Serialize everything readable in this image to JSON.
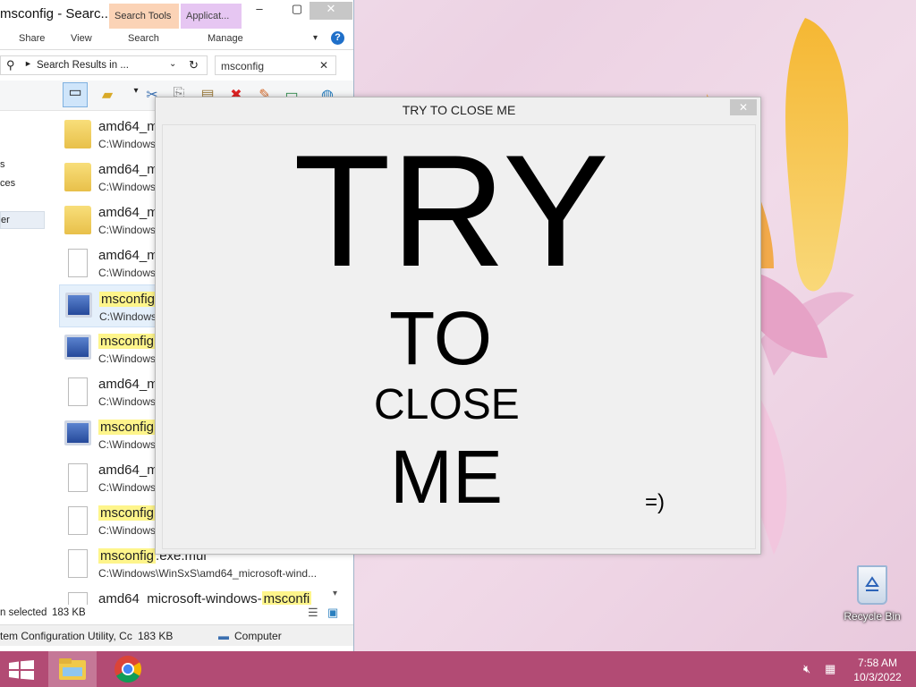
{
  "explorer": {
    "title": "msconfig - Searc...",
    "contextual_tabs": {
      "search_tools": "Search Tools",
      "application": "Applicat..."
    },
    "ribbon_tabs": [
      "Share",
      "View",
      "Search",
      "Manage"
    ],
    "address": "Search Results in ...",
    "search_value": "msconfig",
    "nav_items": [
      "s",
      "ces",
      "er"
    ],
    "files": [
      {
        "name": "amd64_m",
        "highlight": "",
        "path": "C:\\Windows",
        "icon": "folder-icon"
      },
      {
        "name": "amd64_m",
        "highlight": "",
        "path": "C:\\Windows",
        "icon": "folder-icon"
      },
      {
        "name": "amd64_m",
        "highlight": "",
        "path": "C:\\Windows",
        "icon": "folder-icon"
      },
      {
        "name": "amd64_m",
        "highlight": "",
        "path": "C:\\Windows",
        "icon": "file-icon"
      },
      {
        "name": "",
        "highlight": "msconfig",
        "path": "C:\\Windows",
        "icon": "msconfig-app-icon"
      },
      {
        "name": "",
        "highlight": "msconfig",
        "path": "C:\\Windows",
        "icon": "msconfig-app-icon"
      },
      {
        "name": "amd64_m",
        "highlight": "",
        "path": "C:\\Windows",
        "icon": "file-icon"
      },
      {
        "name": "",
        "highlight": "msconfig",
        "path": "C:\\Windows",
        "icon": "msconfig-app-icon"
      },
      {
        "name": "amd64_m",
        "highlight": "",
        "path": "C:\\Windows",
        "icon": "file-icon"
      },
      {
        "name": "",
        "highlight": "msconfig",
        "path": "C:\\Windows",
        "icon": "file-icon"
      },
      {
        "name": ".exe.mui",
        "highlight": "msconfig",
        "path": "C:\\Windows\\WinSxS\\amd64_microsoft-wind...",
        "icon": "file-icon"
      },
      {
        "name": "amd64_microsoft-windows-",
        "highlight": "msconfi",
        "path": "",
        "icon": "file-icon"
      }
    ],
    "status": {
      "selected": "n selected",
      "size": "183 KB"
    },
    "details": {
      "item": "tem Configuration Utility, Cc",
      "size": "183 KB",
      "location": "Computer"
    }
  },
  "dialog": {
    "title": "TRY TO CLOSE ME",
    "close_label": "✕",
    "words": [
      "TRY",
      "TO",
      "CLOSE",
      "ME"
    ],
    "smiley": "=)"
  },
  "desktop": {
    "recycle_bin": "Recycle Bin"
  },
  "taskbar": {
    "time": "7:58 AM",
    "date": "10/3/2022"
  },
  "colors": {
    "taskbar": "#b24b74",
    "highlight": "#fef58b",
    "search_tools_tab": "#fbd3b6",
    "app_tools_tab": "#e6c6f2"
  }
}
